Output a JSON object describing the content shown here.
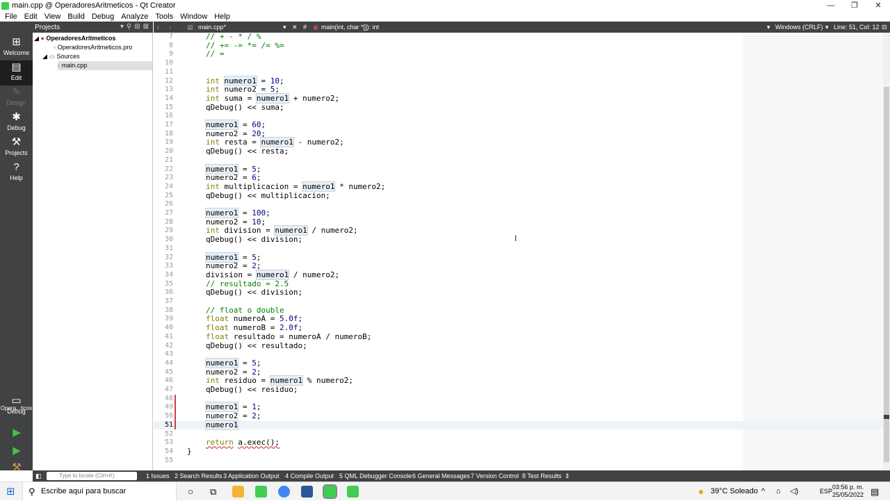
{
  "window": {
    "title": "main.cpp @ OperadoresAritmeticos - Qt Creator",
    "minimize": "—",
    "restore": "❐",
    "close": "✕"
  },
  "menu": [
    "File",
    "Edit",
    "View",
    "Build",
    "Debug",
    "Analyze",
    "Tools",
    "Window",
    "Help"
  ],
  "modes": [
    {
      "label": "Welcome",
      "icon": "grid-icon"
    },
    {
      "label": "Edit",
      "icon": "document-icon"
    },
    {
      "label": "Design",
      "icon": "pencil-icon"
    },
    {
      "label": "Debug",
      "icon": "bug-icon"
    },
    {
      "label": "Projects",
      "icon": "wrench-icon"
    },
    {
      "label": "Help",
      "icon": "help-icon"
    }
  ],
  "kit": {
    "label": "Opera...ticos",
    "mode": "Debug"
  },
  "projects": {
    "header": "Projects",
    "tree": [
      {
        "label": "OperadoresAritmeticos",
        "level": 0
      },
      {
        "label": "OperadoresAritmeticos.pro",
        "level": 1
      },
      {
        "label": "Sources",
        "level": 1
      },
      {
        "label": "main.cpp",
        "level": 2
      }
    ]
  },
  "editor_toolbar": {
    "file": "main.cpp*",
    "symbol_prefix": "#",
    "symbol": "main(int, char *[]): int",
    "encoding": "Windows (CRLF)",
    "position": "Line: 51, Col: 12"
  },
  "editor": {
    "lines": [
      {
        "n": 7,
        "tokens": [
          [
            "c",
            "// + - * / %"
          ]
        ]
      },
      {
        "n": 8,
        "tokens": [
          [
            "c",
            "// += -= *= /= %="
          ]
        ]
      },
      {
        "n": 9,
        "tokens": [
          [
            "c",
            "// ="
          ]
        ]
      },
      {
        "n": 10,
        "tokens": []
      },
      {
        "n": 11,
        "tokens": []
      },
      {
        "n": 12,
        "tokens": [
          [
            "k",
            "int"
          ],
          [
            "t",
            " "
          ],
          [
            "h",
            "numero1"
          ],
          [
            "t",
            " = "
          ],
          [
            "d",
            "10"
          ],
          [
            "t",
            ";"
          ]
        ]
      },
      {
        "n": 13,
        "tokens": [
          [
            "k",
            "int"
          ],
          [
            "t",
            " numero2 = "
          ],
          [
            "d",
            "5"
          ],
          [
            "t",
            ";"
          ]
        ]
      },
      {
        "n": 14,
        "tokens": [
          [
            "k",
            "int"
          ],
          [
            "t",
            " suma = "
          ],
          [
            "h",
            "numero1"
          ],
          [
            "t",
            " + numero2;"
          ]
        ]
      },
      {
        "n": 15,
        "tokens": [
          [
            "t",
            "qDebug() << suma;"
          ]
        ]
      },
      {
        "n": 16,
        "tokens": []
      },
      {
        "n": 17,
        "tokens": [
          [
            "h",
            "numero1"
          ],
          [
            "t",
            " = "
          ],
          [
            "d",
            "60"
          ],
          [
            "t",
            ";"
          ]
        ]
      },
      {
        "n": 18,
        "tokens": [
          [
            "t",
            "numero2 = "
          ],
          [
            "d",
            "20"
          ],
          [
            "t",
            ";"
          ]
        ]
      },
      {
        "n": 19,
        "tokens": [
          [
            "k",
            "int"
          ],
          [
            "t",
            " resta = "
          ],
          [
            "h",
            "numero1"
          ],
          [
            "t",
            " - numero2;"
          ]
        ]
      },
      {
        "n": 20,
        "tokens": [
          [
            "t",
            "qDebug() << resta;"
          ]
        ]
      },
      {
        "n": 21,
        "tokens": []
      },
      {
        "n": 22,
        "tokens": [
          [
            "h",
            "numero1"
          ],
          [
            "t",
            " = "
          ],
          [
            "d",
            "5"
          ],
          [
            "t",
            ";"
          ]
        ]
      },
      {
        "n": 23,
        "tokens": [
          [
            "t",
            "numero2 = "
          ],
          [
            "d",
            "6"
          ],
          [
            "t",
            ";"
          ]
        ]
      },
      {
        "n": 24,
        "tokens": [
          [
            "k",
            "int"
          ],
          [
            "t",
            " multiplicacion = "
          ],
          [
            "h",
            "numero1"
          ],
          [
            "t",
            " * numero2;"
          ]
        ]
      },
      {
        "n": 25,
        "tokens": [
          [
            "t",
            "qDebug() << multiplicacion;"
          ]
        ]
      },
      {
        "n": 26,
        "tokens": []
      },
      {
        "n": 27,
        "tokens": [
          [
            "h",
            "numero1"
          ],
          [
            "t",
            " = "
          ],
          [
            "d",
            "100"
          ],
          [
            "t",
            ";"
          ]
        ]
      },
      {
        "n": 28,
        "tokens": [
          [
            "t",
            "numero2 = "
          ],
          [
            "d",
            "10"
          ],
          [
            "t",
            ";"
          ]
        ]
      },
      {
        "n": 29,
        "tokens": [
          [
            "k",
            "int"
          ],
          [
            "t",
            " division = "
          ],
          [
            "h",
            "numero1"
          ],
          [
            "t",
            " / numero2;"
          ]
        ]
      },
      {
        "n": 30,
        "tokens": [
          [
            "t",
            "qDebug() << division;"
          ]
        ]
      },
      {
        "n": 31,
        "tokens": []
      },
      {
        "n": 32,
        "tokens": [
          [
            "h",
            "numero1"
          ],
          [
            "t",
            " = "
          ],
          [
            "d",
            "5"
          ],
          [
            "t",
            ";"
          ]
        ]
      },
      {
        "n": 33,
        "tokens": [
          [
            "t",
            "numero2 = "
          ],
          [
            "d",
            "2"
          ],
          [
            "t",
            ";"
          ]
        ]
      },
      {
        "n": 34,
        "tokens": [
          [
            "t",
            "division = "
          ],
          [
            "h",
            "numero1"
          ],
          [
            "t",
            " / numero2;"
          ]
        ]
      },
      {
        "n": 35,
        "tokens": [
          [
            "c",
            "// resultado = 2.5"
          ]
        ]
      },
      {
        "n": 36,
        "tokens": [
          [
            "t",
            "qDebug() << division;"
          ]
        ]
      },
      {
        "n": 37,
        "tokens": []
      },
      {
        "n": 38,
        "tokens": [
          [
            "c",
            "// float o double"
          ]
        ]
      },
      {
        "n": 39,
        "tokens": [
          [
            "k",
            "float"
          ],
          [
            "t",
            " numeroA = "
          ],
          [
            "d",
            "5.0f"
          ],
          [
            "t",
            ";"
          ]
        ]
      },
      {
        "n": 40,
        "tokens": [
          [
            "k",
            "float"
          ],
          [
            "t",
            " numeroB = "
          ],
          [
            "d",
            "2.0f"
          ],
          [
            "t",
            ";"
          ]
        ]
      },
      {
        "n": 41,
        "tokens": [
          [
            "k",
            "float"
          ],
          [
            "t",
            " resultado = numeroA / numeroB;"
          ]
        ]
      },
      {
        "n": 42,
        "tokens": [
          [
            "t",
            "qDebug() << resultado;"
          ]
        ]
      },
      {
        "n": 43,
        "tokens": []
      },
      {
        "n": 44,
        "tokens": [
          [
            "h",
            "numero1"
          ],
          [
            "t",
            " = "
          ],
          [
            "d",
            "5"
          ],
          [
            "t",
            ";"
          ]
        ]
      },
      {
        "n": 45,
        "tokens": [
          [
            "t",
            "numero2 = "
          ],
          [
            "d",
            "2"
          ],
          [
            "t",
            ";"
          ]
        ]
      },
      {
        "n": 46,
        "tokens": [
          [
            "k",
            "int"
          ],
          [
            "t",
            " residuo = "
          ],
          [
            "h",
            "numero1"
          ],
          [
            "t",
            " % numero2;"
          ]
        ]
      },
      {
        "n": 47,
        "tokens": [
          [
            "t",
            "qDebug() << residuo;"
          ]
        ]
      },
      {
        "n": 48,
        "tokens": [],
        "changed": true
      },
      {
        "n": 49,
        "tokens": [
          [
            "h",
            "numero1"
          ],
          [
            "t",
            " = "
          ],
          [
            "d",
            "1"
          ],
          [
            "t",
            ";"
          ]
        ],
        "changed": true
      },
      {
        "n": 50,
        "tokens": [
          [
            "t",
            "numero2 = "
          ],
          [
            "d",
            "2"
          ],
          [
            "t",
            ";"
          ]
        ],
        "changed": true
      },
      {
        "n": 51,
        "tokens": [
          [
            "h",
            "numero1"
          ]
        ],
        "changed": true,
        "current": true
      },
      {
        "n": 52,
        "tokens": []
      },
      {
        "n": 53,
        "tokens": [
          [
            "r",
            "return"
          ],
          [
            "t",
            " "
          ],
          [
            "e",
            "a.exec();"
          ]
        ]
      },
      {
        "n": 54,
        "tokens": [
          [
            "b",
            "}"
          ]
        ]
      },
      {
        "n": 55,
        "tokens": []
      }
    ]
  },
  "output_tabs": {
    "locator_placeholder": "Type to locate (Ctrl+K)",
    "tabs": [
      "1  Issues",
      "2  Search Results",
      "3  Application Output",
      "4  Compile Output",
      "5  QML Debugger Console",
      "6  General Messages",
      "7  Version Control",
      "8  Test Results"
    ]
  },
  "taskbar": {
    "search_placeholder": "Escribe aquí para buscar",
    "weather": "39°C  Soleado",
    "language": "ESP",
    "time": "03:56 p. m.",
    "date": "25/05/2022",
    "colors": {
      "explorer": "#f2b632",
      "qt": "#41cd52",
      "chrome": "#4285f4",
      "word": "#2b579a"
    }
  }
}
